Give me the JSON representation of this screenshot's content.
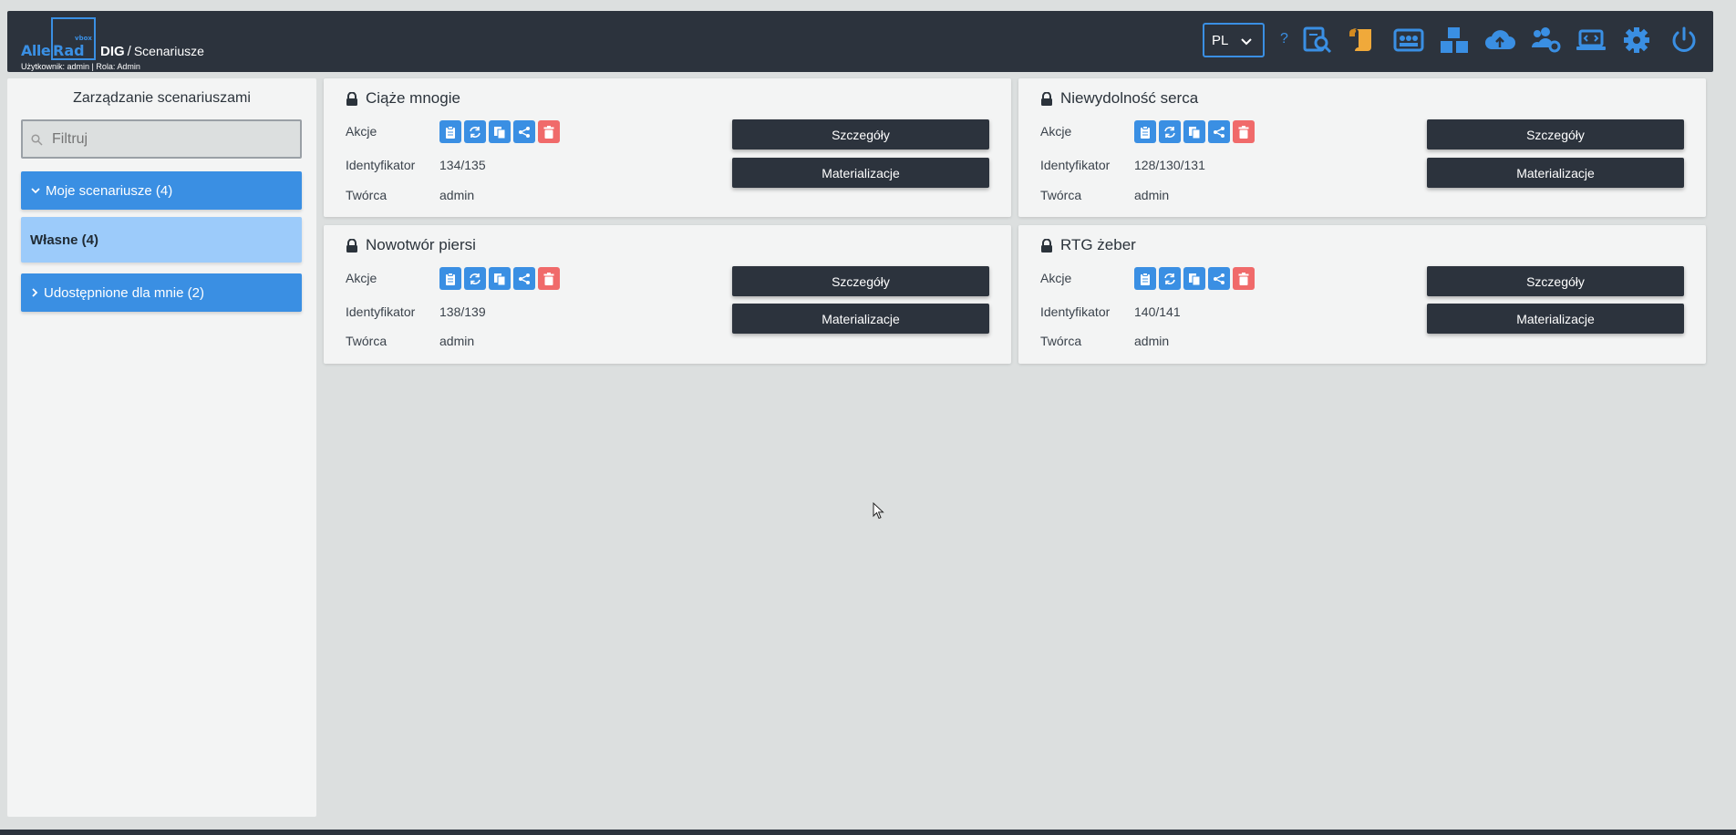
{
  "header": {
    "logo": {
      "alle": "Alle",
      "rad": "Rad",
      "vbox": "vbox"
    },
    "app_name": "DIG",
    "separator": "/",
    "page": "Scenariusze",
    "user_line": "Użytkownik: admin | Rola: Admin",
    "language": "PL",
    "help": "?",
    "icons": [
      "search-document-icon",
      "scroll-icon",
      "id-cards-icon",
      "boxes-icon",
      "cloud-upload-icon",
      "users-settings-icon",
      "laptop-code-icon",
      "gear-icon",
      "power-icon"
    ],
    "accent": "#3a8fe3"
  },
  "sidebar": {
    "title": "Zarządzanie scenariuszami",
    "filter_placeholder": "Filtruj",
    "groups": [
      {
        "label": "Moje scenariusze (4)",
        "expanded": true
      },
      {
        "label": "Udostępnione dla mnie (2)",
        "expanded": false
      }
    ],
    "sub_items": [
      {
        "label": "Własne (4)",
        "selected": true
      }
    ]
  },
  "labels": {
    "actions": "Akcje",
    "identifier": "Identyfikator",
    "creator": "Twórca",
    "details_btn": "Szczegóły",
    "materialize_btn": "Materializacje"
  },
  "scenarios": [
    {
      "name": "Ciąże mnogie",
      "identifier": "134/135",
      "creator": "admin"
    },
    {
      "name": "Niewydolność serca",
      "identifier": "128/130/131",
      "creator": "admin"
    },
    {
      "name": "Nowotwór piersi",
      "identifier": "138/139",
      "creator": "admin"
    },
    {
      "name": "RTG żeber",
      "identifier": "140/141",
      "creator": "admin"
    }
  ],
  "colors": {
    "dark": "#2c333d",
    "blue": "#3a8fe3",
    "light_blue": "#9ccbfa",
    "delete_red": "#f06a6a",
    "orange_icon": "#f0a93a"
  }
}
